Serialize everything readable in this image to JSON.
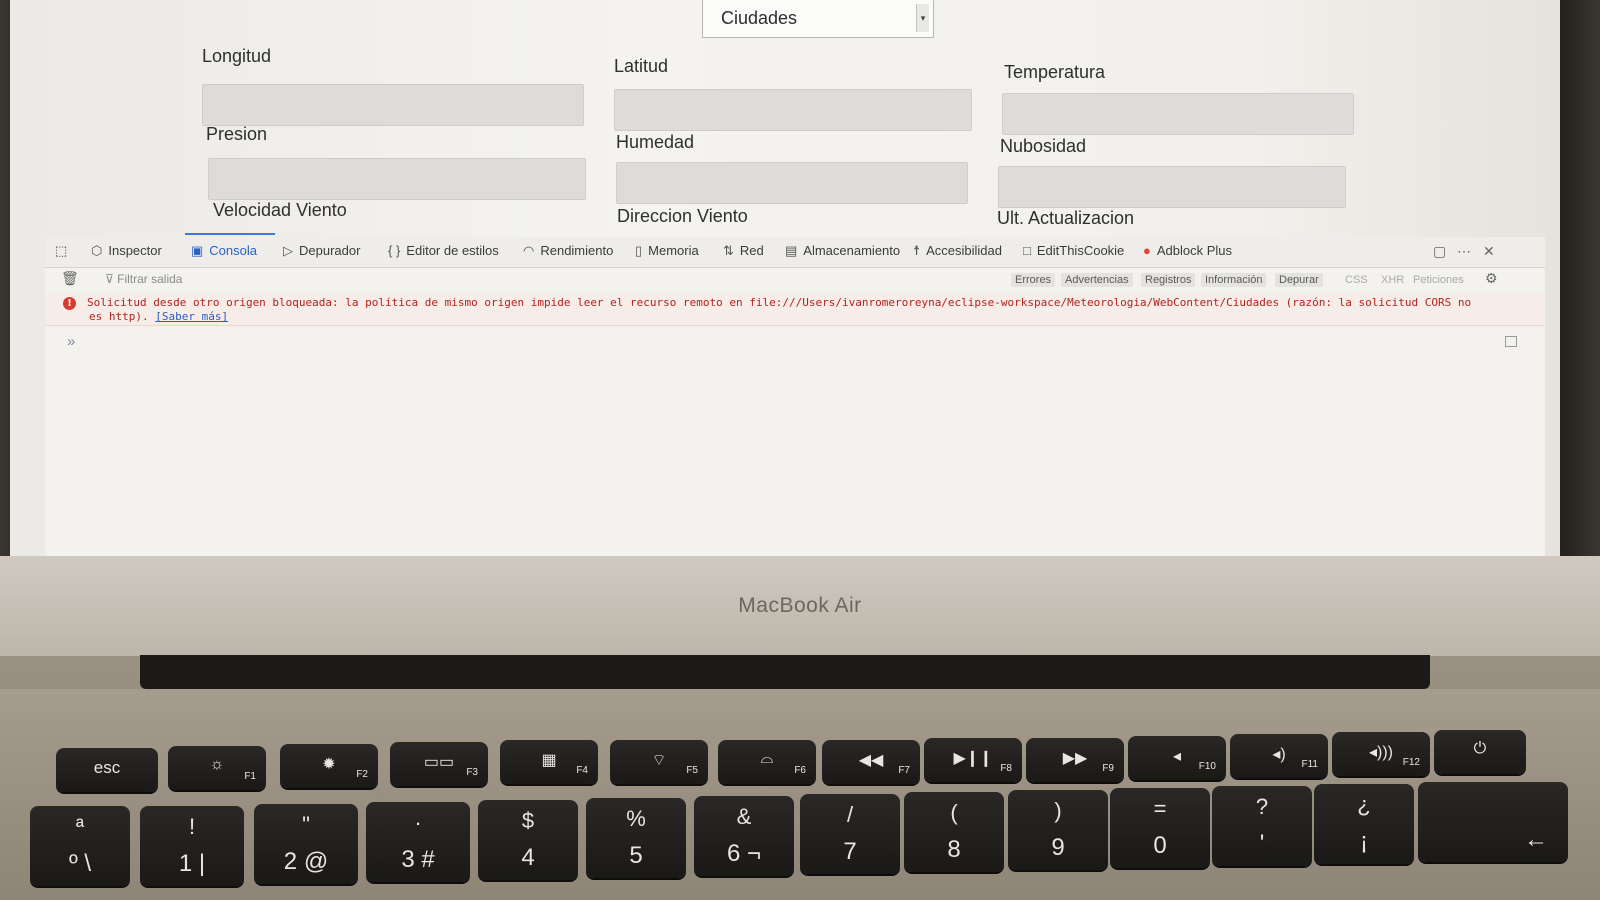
{
  "form": {
    "select_value": "Ciudades",
    "fields": [
      {
        "label": "Longitud",
        "value": ""
      },
      {
        "label": "Latitud",
        "value": ""
      },
      {
        "label": "Temperatura",
        "value": ""
      },
      {
        "label": "Presion",
        "value": ""
      },
      {
        "label": "Humedad",
        "value": ""
      },
      {
        "label": "Nubosidad",
        "value": ""
      },
      {
        "label": "Velocidad Viento",
        "value": ""
      },
      {
        "label": "Direccion Viento",
        "value": ""
      },
      {
        "label": "Ult. Actualizacion",
        "value": ""
      }
    ]
  },
  "devtools": {
    "tabs": [
      {
        "label": "Inspector",
        "icon": "inspector-icon"
      },
      {
        "label": "Consola",
        "icon": "console-icon",
        "active": true
      },
      {
        "label": "Depurador",
        "icon": "debugger-icon"
      },
      {
        "label": "Editor de estilos",
        "icon": "braces-icon"
      },
      {
        "label": "Rendimiento",
        "icon": "gauge-icon"
      },
      {
        "label": "Memoria",
        "icon": "memory-icon"
      },
      {
        "label": "Red",
        "icon": "network-arrows-icon"
      },
      {
        "label": "Almacenamiento",
        "icon": "storage-icon"
      },
      {
        "label": "Accesibilidad",
        "icon": "accessibility-icon"
      },
      {
        "label": "EditThisCookie",
        "icon": "cookie-icon"
      },
      {
        "label": "Adblock Plus",
        "icon": "adblock-icon"
      }
    ],
    "filter_placeholder": "Filtrar salida",
    "log_filters": [
      "Errores",
      "Advertencias",
      "Registros",
      "Información",
      "Depurar",
      "CSS",
      "XHR",
      "Peticiones"
    ],
    "message": {
      "line1": "Solicitud desde otro origen bloqueada: la política de mismo origen impide leer el recurso remoto en file:///Users/ivanromeroreyna/eclipse-workspace/Meteorologia/WebContent/Ciudades (razón: la solicitud CORS no",
      "line2_prefix": "es http). ",
      "learn_more": "[Saber más]"
    },
    "accent_color": "#3b7be0",
    "error_color": "#b3231e"
  },
  "device_label": "MacBook Air",
  "keyboard": {
    "fn_row": [
      "esc",
      "F1",
      "F2",
      "F3",
      "F4",
      "F5",
      "F6",
      "F7",
      "F8",
      "F9",
      "F10",
      "F11",
      "F12"
    ],
    "number_row": [
      {
        "top": "ª",
        "bottom": "º \\"
      },
      {
        "top": "!",
        "bottom": "1 |"
      },
      {
        "top": "\"",
        "bottom": "2 @"
      },
      {
        "top": "·",
        "bottom": "3 #"
      },
      {
        "top": "$",
        "bottom": "4"
      },
      {
        "top": "%",
        "bottom": "5"
      },
      {
        "top": "&",
        "bottom": "6 ¬"
      },
      {
        "top": "/",
        "bottom": "7"
      },
      {
        "top": "(",
        "bottom": "8"
      },
      {
        "top": ")",
        "bottom": "9"
      },
      {
        "top": "=",
        "bottom": "0"
      },
      {
        "top": "?",
        "bottom": "'"
      },
      {
        "top": "¿",
        "bottom": "¡"
      }
    ]
  }
}
